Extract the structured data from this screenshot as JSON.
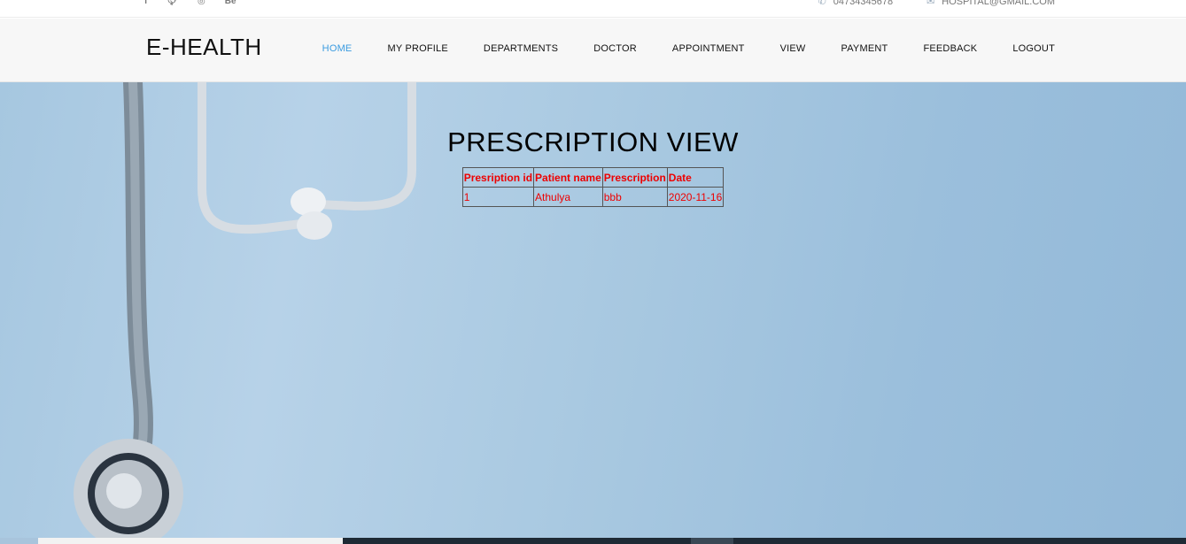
{
  "topbar": {
    "social": [
      "f",
      "♣",
      "◎",
      "Be"
    ],
    "phone": "04734345678",
    "email": "HOSPITAL@GMAIL.COM"
  },
  "header": {
    "logo": "E-HEALTH",
    "nav": [
      {
        "label": "HOME",
        "active": true
      },
      {
        "label": "MY PROFILE"
      },
      {
        "label": "DEPARTMENTS"
      },
      {
        "label": "DOCTOR"
      },
      {
        "label": "APPOINTMENT"
      },
      {
        "label": "VIEW"
      },
      {
        "label": "PAYMENT"
      },
      {
        "label": "FEEDBACK"
      },
      {
        "label": "LOGOUT"
      }
    ]
  },
  "main": {
    "title": "PRESCRIPTION VIEW",
    "table": {
      "headers": [
        "Presription id",
        "Patient name",
        "Prescription",
        "Date"
      ],
      "rows": [
        [
          "1",
          "Athulya",
          "bbb",
          "2020-11-16"
        ]
      ]
    }
  },
  "colors": {
    "accent": "#3a9be0",
    "table_text": "#e00000"
  }
}
